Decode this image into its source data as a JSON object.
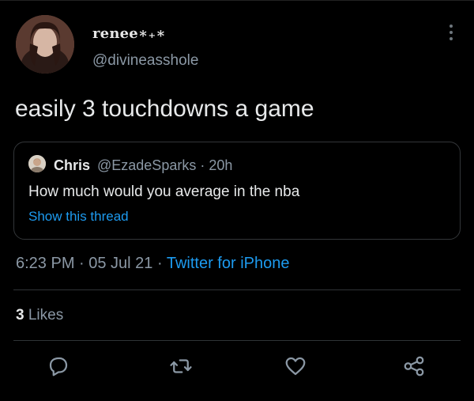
{
  "tweet": {
    "display_name": "renee∗₊∗",
    "handle": "@divineasshole",
    "text": "easily 3 touchdowns a game",
    "timestamp": "6:23 PM · 05 Jul 21 · ",
    "client": "Twitter for iPhone",
    "likes_count": "3",
    "likes_label": "Likes"
  },
  "quoted": {
    "name": "Chris",
    "meta": "@EzadeSparks · 20h",
    "text": "How much would you average in the nba",
    "link": "Show this thread"
  },
  "actions": [
    "reply-icon",
    "retweet-icon",
    "like-icon",
    "share-icon"
  ],
  "colors": {
    "background": "#000000",
    "link": "#1d9bf0",
    "muted": "#8b98a5"
  }
}
